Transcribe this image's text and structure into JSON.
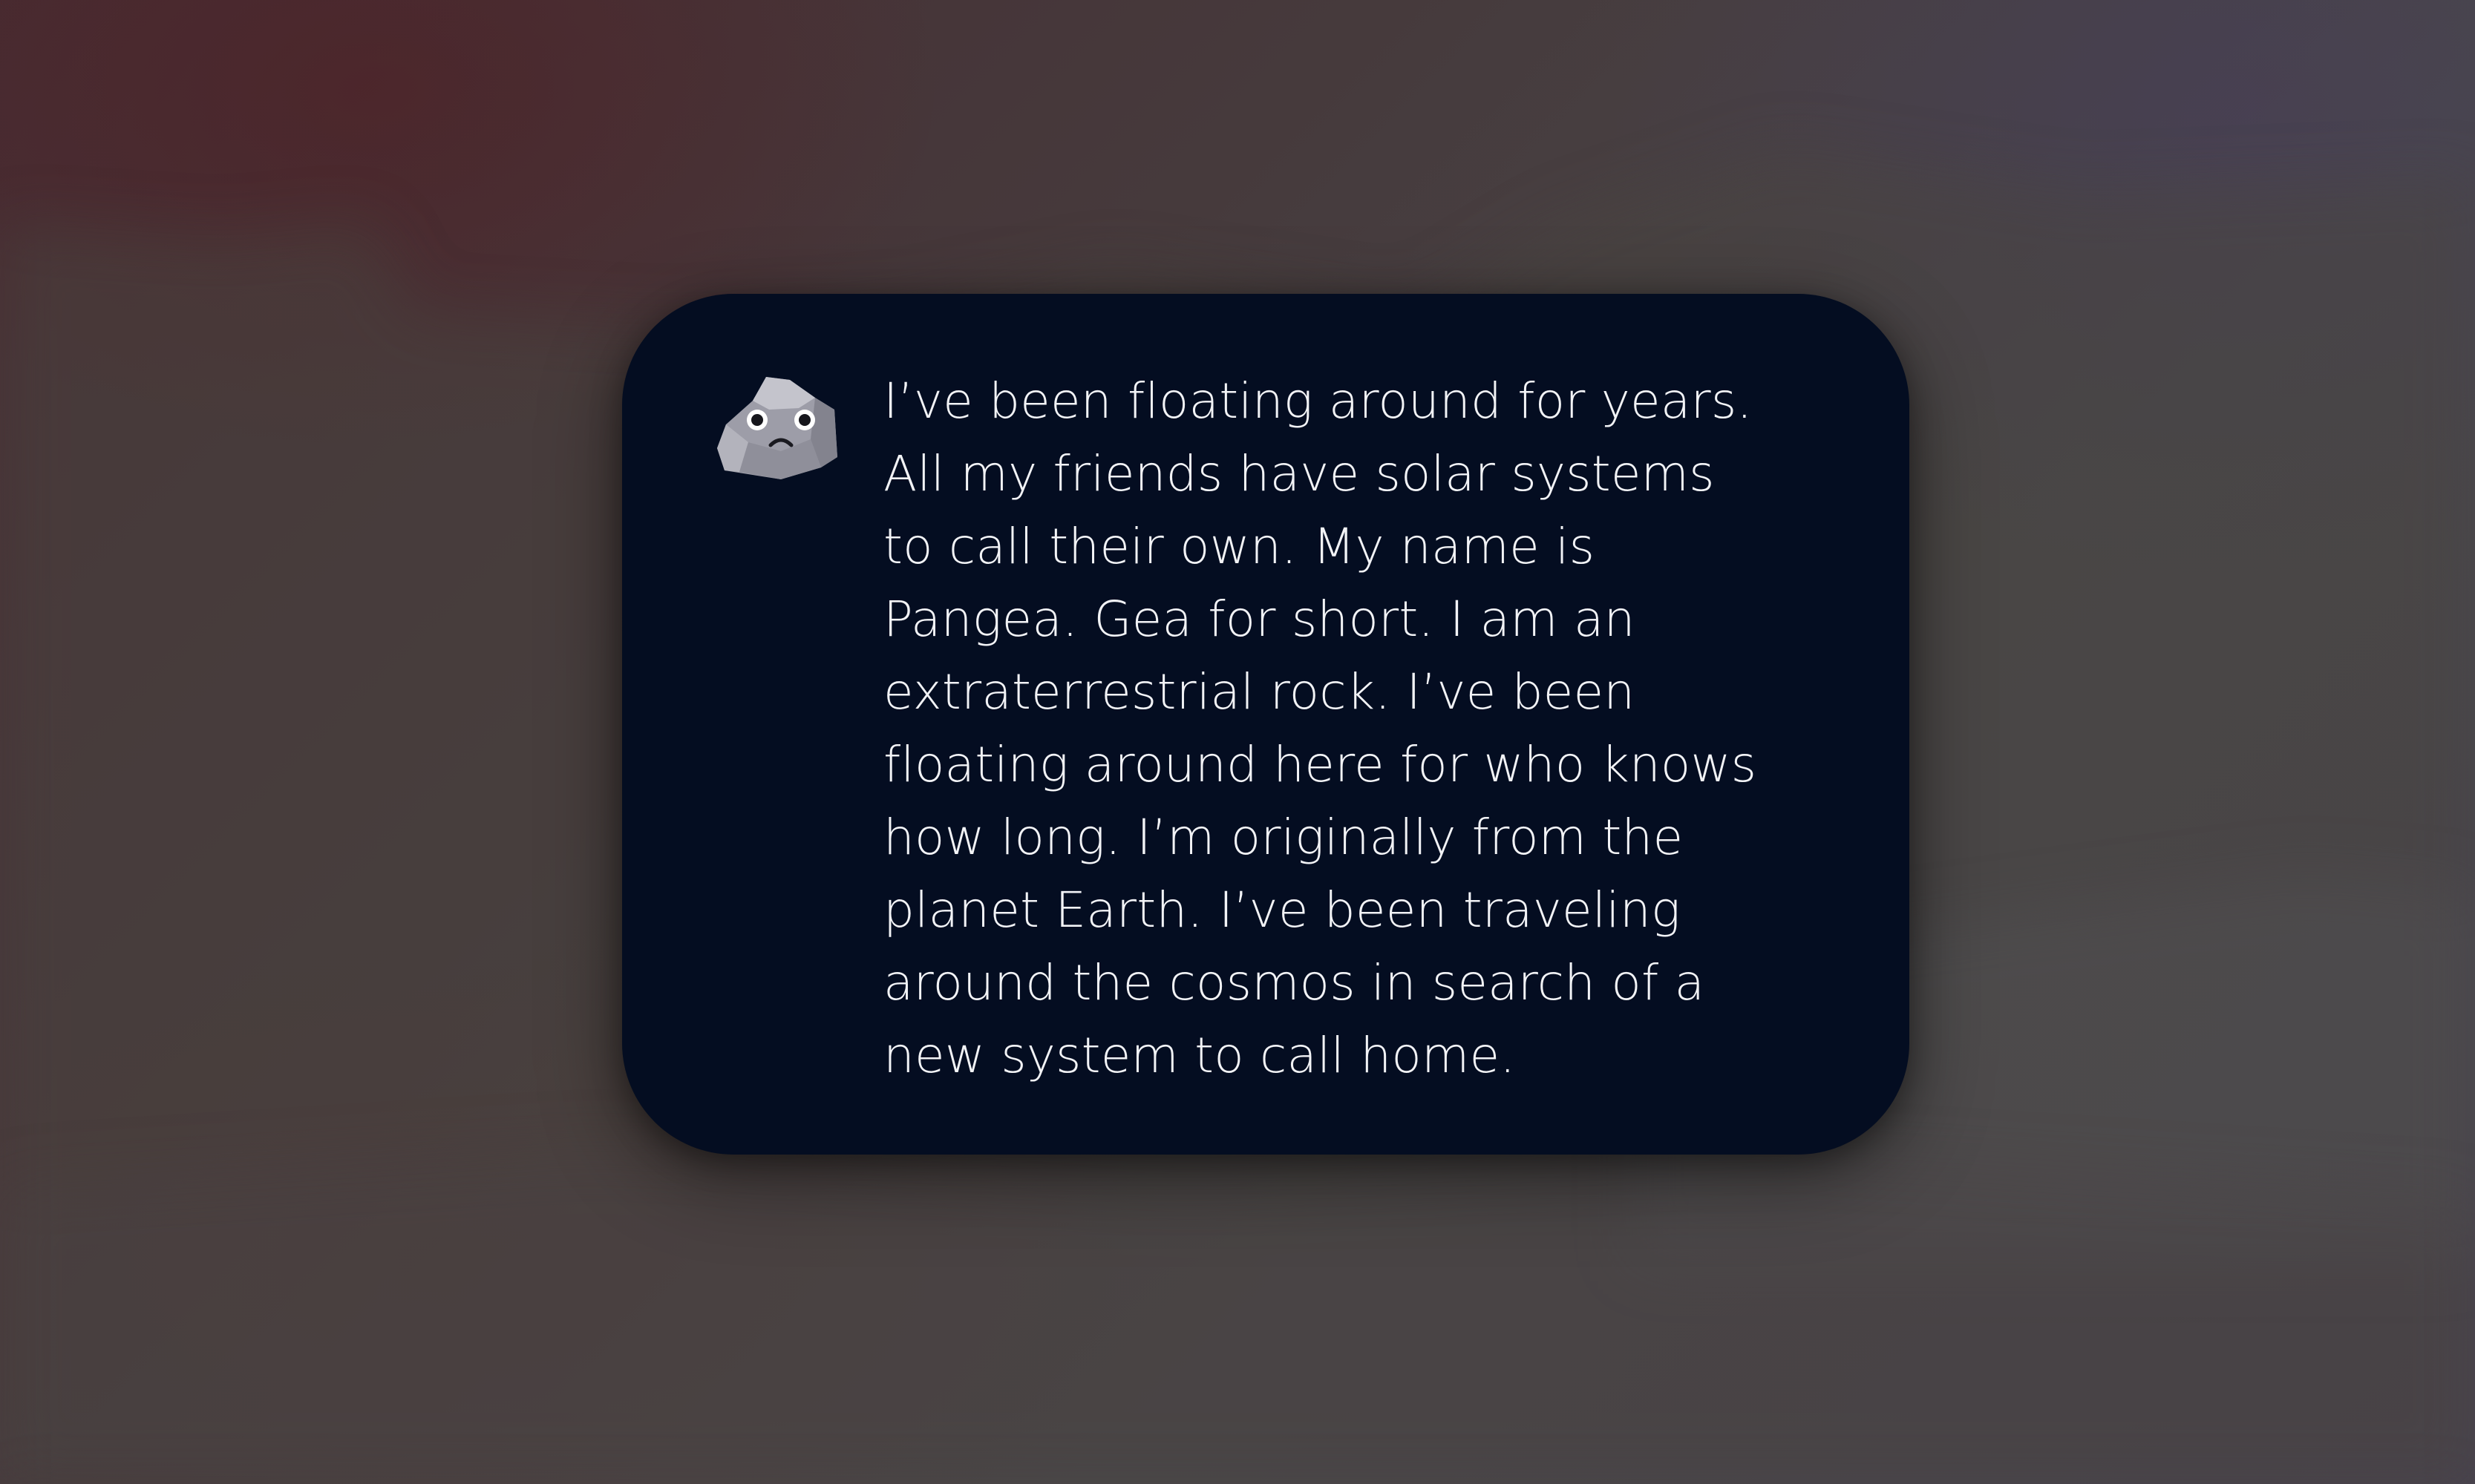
{
  "dialog": {
    "speaker_icon": "rock-character-icon",
    "text": "I’ve been floating around for years.\nAll my friends have solar systems\nto call their own. My name is\nPangea. Gea for short. I am an\nextraterrestrial rock. I’ve been\nfloating around here for who knows\nhow long. I’m originally from the\nplanet Earth. I’ve been traveling\naround the cosmos in search of a\nnew system to call home."
  },
  "colors": {
    "card_background": "#040d21",
    "text": "#f2f3f6",
    "rock_light": "#b9b9c2",
    "rock_dark": "#8d8d98"
  }
}
